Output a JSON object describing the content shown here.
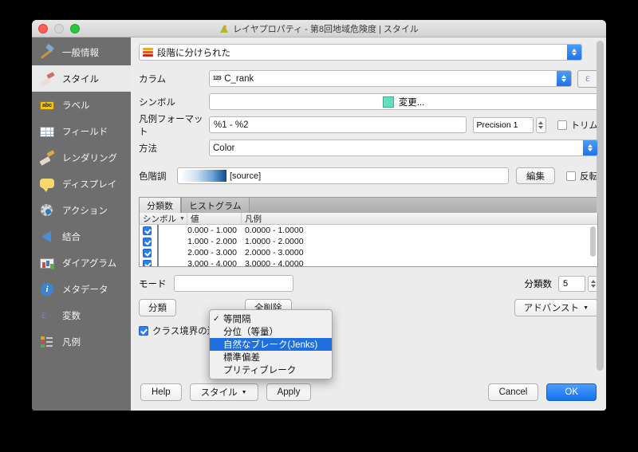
{
  "window": {
    "title": "レイヤプロパティ - 第8回地域危険度 | スタイル",
    "app_icon": "qgis-icon"
  },
  "sidebar": {
    "items": [
      {
        "label": "一般情報",
        "icon": "hammer-icon",
        "selected": false
      },
      {
        "label": "スタイル",
        "icon": "brush-icon",
        "selected": true
      },
      {
        "label": "ラベル",
        "icon": "abc-icon",
        "selected": false
      },
      {
        "label": "フィールド",
        "icon": "table-icon",
        "selected": false
      },
      {
        "label": "レンダリング",
        "icon": "render-brush-icon",
        "selected": false
      },
      {
        "label": "ディスプレイ",
        "icon": "speech-bubble-icon",
        "selected": false
      },
      {
        "label": "アクション",
        "icon": "gear-icon",
        "selected": false
      },
      {
        "label": "結合",
        "icon": "join-arrow-icon",
        "selected": false
      },
      {
        "label": "ダイアグラム",
        "icon": "diagram-icon",
        "selected": false
      },
      {
        "label": "メタデータ",
        "icon": "info-icon",
        "selected": false
      },
      {
        "label": "変数",
        "icon": "epsilon-icon",
        "selected": false
      },
      {
        "label": "凡例",
        "icon": "legend-icon",
        "selected": false
      }
    ]
  },
  "renderer": {
    "value": "段階に分けられた"
  },
  "form": {
    "column_label": "カラム",
    "column_value": "C_rank",
    "column_type_badge": "123",
    "expression_button": "ε",
    "symbol_label": "シンボル",
    "symbol_change_label": "変更...",
    "symbol_color": "#62e0bb",
    "legend_format_label": "凡例フォーマット",
    "legend_format_value": "%1 - %2",
    "precision_label": "Precision",
    "precision_value": "1",
    "trim_label": "トリム",
    "trim_checked": false,
    "method_label": "方法",
    "method_value": "Color",
    "ramp_label": "色階調",
    "ramp_value": "[source]",
    "edit_button": "編集",
    "invert_label": "反転",
    "invert_checked": false
  },
  "tabs": [
    {
      "label": "分類数",
      "active": true
    },
    {
      "label": "ヒストグラム",
      "active": false
    }
  ],
  "table": {
    "headers": [
      "シンボル",
      "値",
      "凡例"
    ],
    "rows": [
      {
        "checked": true,
        "color": "#f5fafe",
        "value": "0.000 - 1.000",
        "legend": "0.0000 - 1.0000"
      },
      {
        "checked": true,
        "color": "#cfe1f2",
        "value": "1.000 - 2.000",
        "legend": "1.0000 - 2.0000"
      },
      {
        "checked": true,
        "color": "#8cb9dd",
        "value": "2.000 - 3.000",
        "legend": "2.0000 - 3.0000"
      },
      {
        "checked": true,
        "color": "#3d83bd",
        "value": "3.000 - 4.000",
        "legend": "3.0000 - 4.0000"
      }
    ]
  },
  "mode": {
    "label": "モード",
    "classes_label": "分類数",
    "classes_value": "5",
    "menu_items": [
      {
        "label": "等間隔",
        "checked": true,
        "highlighted": false
      },
      {
        "label": "分位（等量）",
        "checked": false,
        "highlighted": false
      },
      {
        "label": "自然なブレーク(Jenks)",
        "checked": false,
        "highlighted": true
      },
      {
        "label": "標準偏差",
        "checked": false,
        "highlighted": false
      },
      {
        "label": "プリティブレーク",
        "checked": false,
        "highlighted": false
      }
    ]
  },
  "actions": {
    "classify_button": "分類",
    "delete_all_button": "全削除",
    "advanced_button": "アドバンスト",
    "link_boundaries_label": "クラス境界の連結",
    "link_boundaries_checked": true
  },
  "footer": {
    "help": "Help",
    "style": "スタイル",
    "apply": "Apply",
    "cancel": "Cancel",
    "ok": "OK"
  }
}
